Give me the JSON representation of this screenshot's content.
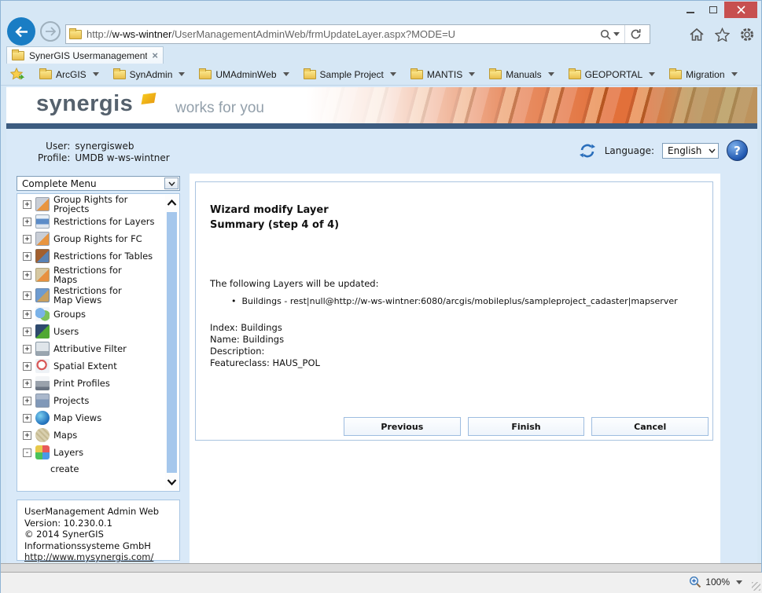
{
  "browser": {
    "url_scheme": "http://",
    "url_domain": "w-ws-wintner",
    "url_path": "/UserManagementAdminWeb/frmUpdateLayer.aspx?MODE=U",
    "tab_title": "SynerGIS Usermanagement ...",
    "tab_close": "×",
    "zoom_level": "100%"
  },
  "favorites": {
    "items": [
      {
        "label": "ArcGIS"
      },
      {
        "label": "SynAdmin"
      },
      {
        "label": "UMAdminWeb"
      },
      {
        "label": "Sample Project"
      },
      {
        "label": "MANTIS"
      },
      {
        "label": "Manuals"
      },
      {
        "label": "GEOPORTAL"
      },
      {
        "label": "Migration"
      }
    ]
  },
  "banner": {
    "logo_text": "synergis",
    "tagline": "works for you"
  },
  "header": {
    "user_label": "User:",
    "user_value": "synergisweb",
    "profile_label": "Profile:",
    "profile_value": "UMDB w-ws-wintner",
    "language_label": "Language:",
    "language_value": "English",
    "help_glyph": "?"
  },
  "sidebar": {
    "menu_filter": "Complete Menu",
    "tree": [
      {
        "expander": "+",
        "label": "Group Rights for Projects"
      },
      {
        "expander": "+",
        "label": "Restrictions for Layers"
      },
      {
        "expander": "+",
        "label": "Group Rights for FC"
      },
      {
        "expander": "+",
        "label": "Restrictions for Tables"
      },
      {
        "expander": "+",
        "label": "Restrictions for Maps"
      },
      {
        "expander": "+",
        "label": "Restrictions for Map Views"
      },
      {
        "expander": "+",
        "label": "Groups"
      },
      {
        "expander": "+",
        "label": "Users"
      },
      {
        "expander": "+",
        "label": "Attributive Filter"
      },
      {
        "expander": "+",
        "label": "Spatial Extent"
      },
      {
        "expander": "+",
        "label": "Print Profiles"
      },
      {
        "expander": "+",
        "label": "Projects"
      },
      {
        "expander": "+",
        "label": "Map Views"
      },
      {
        "expander": "+",
        "label": "Maps"
      },
      {
        "expander": "-",
        "label": "Layers"
      }
    ],
    "tree_child": "create",
    "about": {
      "product": "UserManagement Admin Web",
      "version": "Version: 10.230.0.1",
      "copyright": "© 2014 SynerGIS",
      "company": "Informationssysteme GmbH",
      "link": "http://www.mysynergis.com/"
    }
  },
  "wizard": {
    "title": "Wizard modify Layer",
    "subtitle": "Summary (step 4 of 4)",
    "intro": "The following Layers will be updated:",
    "layer_bullet": "Buildings - rest|null@http://w-ws-wintner:6080/arcgis/mobileplus/sampleproject_cadaster|mapserver",
    "index_line": "Index: Buildings",
    "name_line": "Name: Buildings",
    "description_line": "Description:",
    "featureclass_line": "Featureclass: HAUS_POL",
    "previous_label": "Previous",
    "finish_label": "Finish",
    "cancel_label": "Cancel"
  }
}
